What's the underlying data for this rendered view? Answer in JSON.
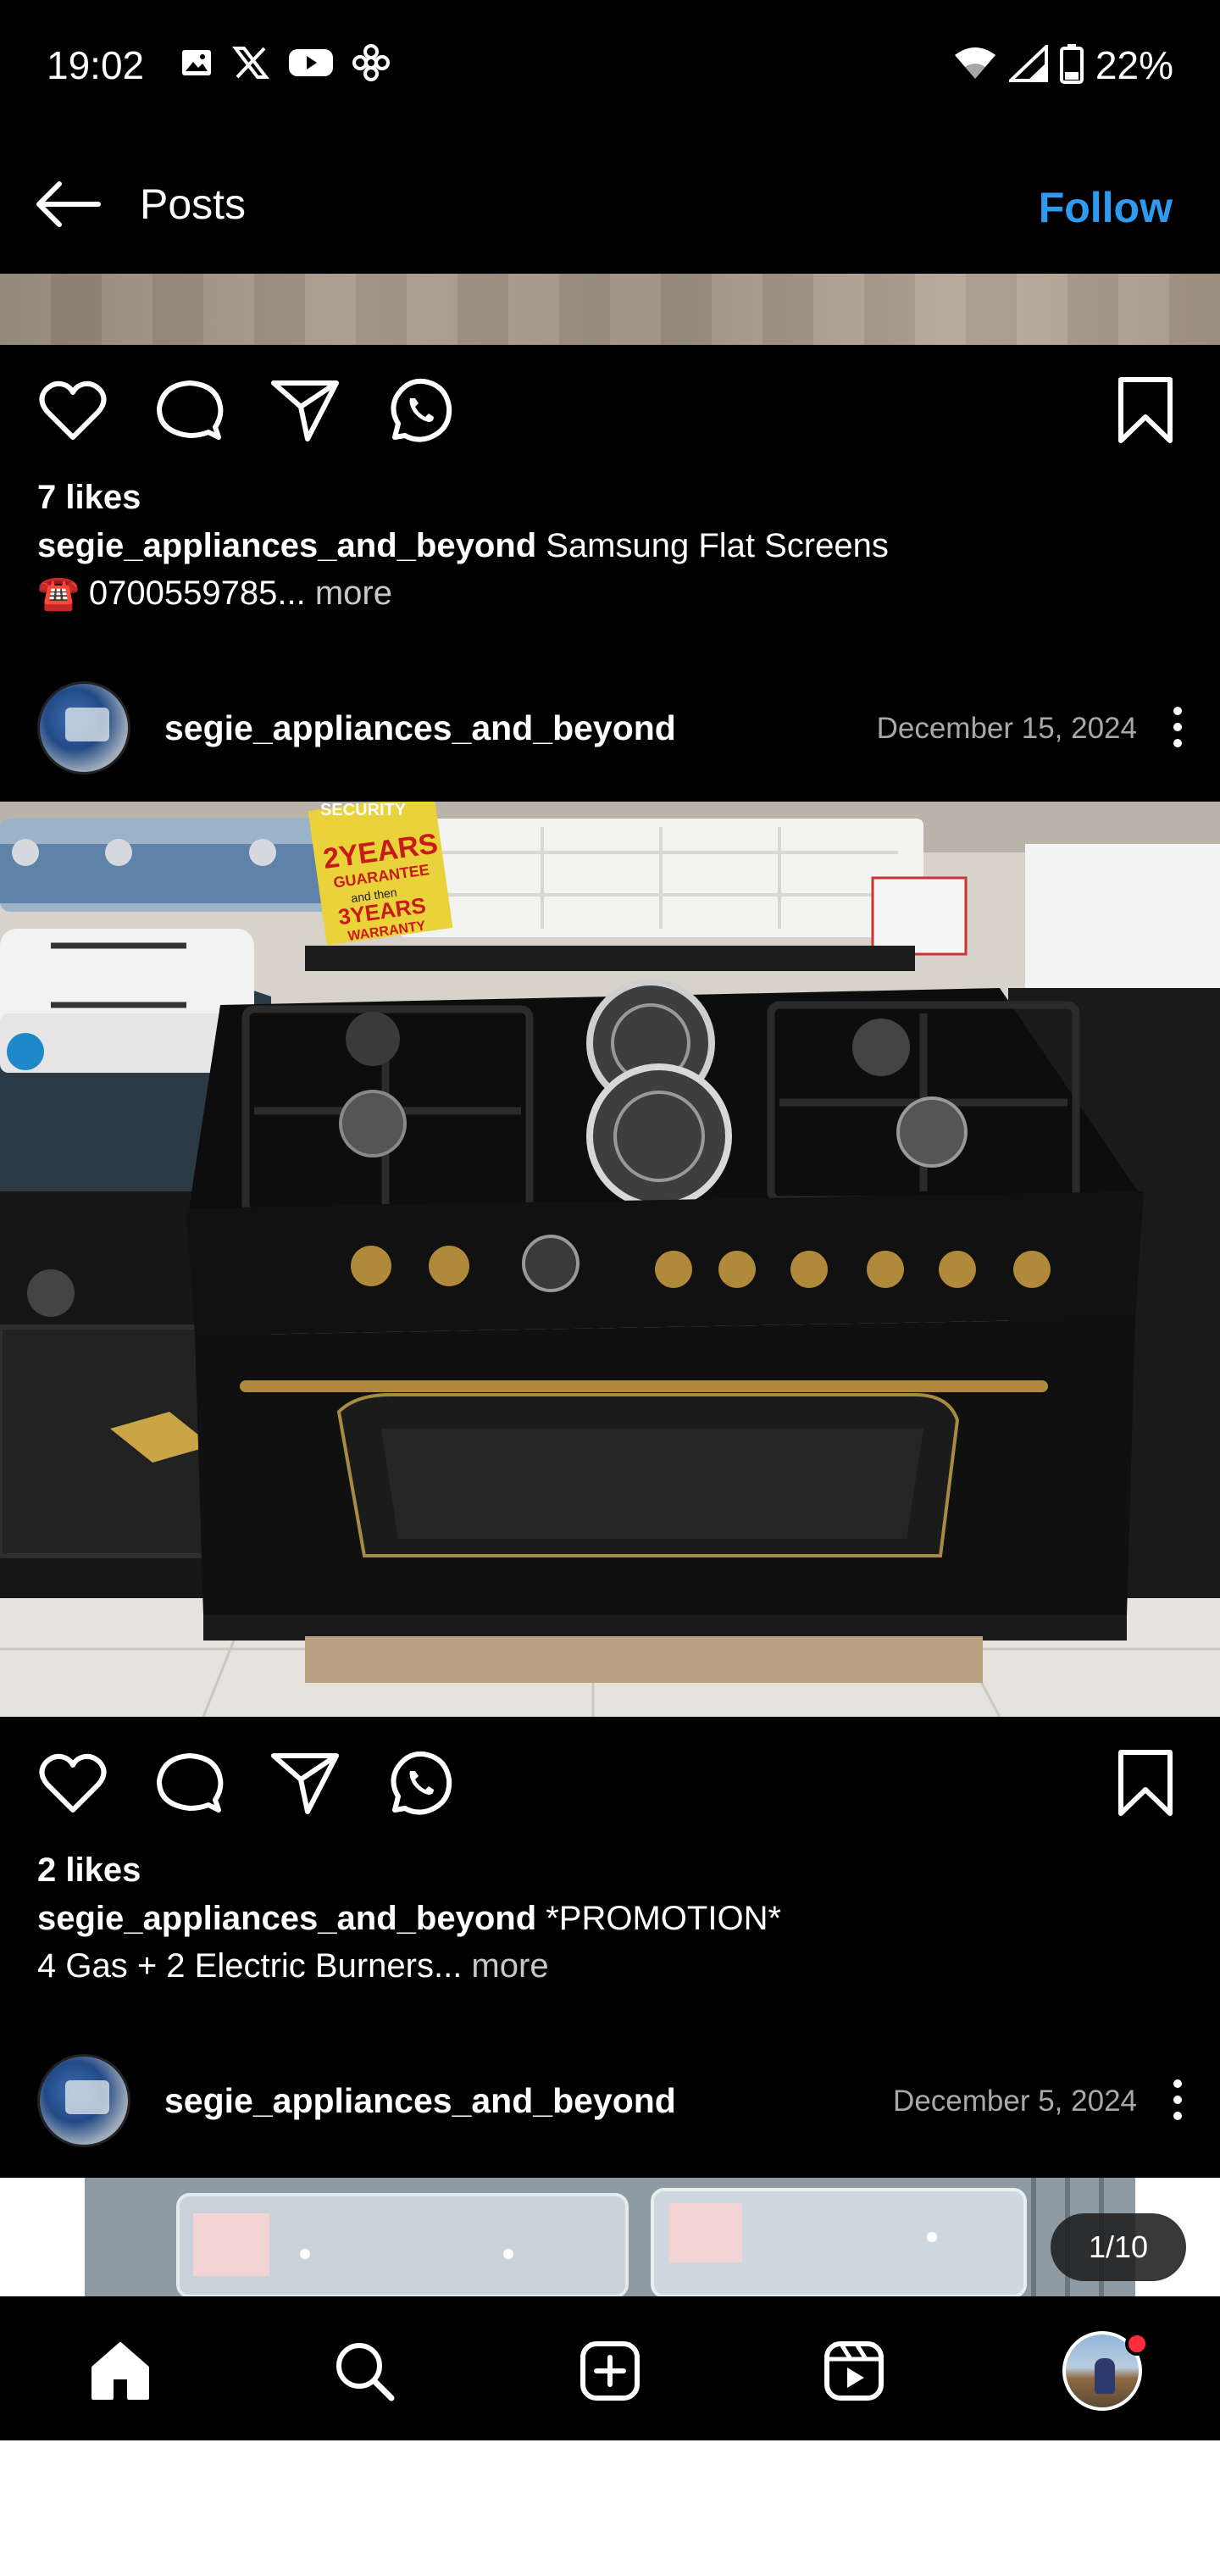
{
  "status_bar": {
    "time": "19:02",
    "battery": "22%",
    "left_icons": [
      "gallery-icon",
      "x-icon",
      "youtube-icon",
      "app-icon"
    ],
    "right_icons": [
      "wifi-icon",
      "signal-icon",
      "battery-icon"
    ]
  },
  "header": {
    "title": "Posts",
    "follow_label": "Follow"
  },
  "colors": {
    "follow": "#2f9bf0",
    "background": "#000000",
    "date": "#a8a8a8",
    "notification": "#ff2a3a"
  },
  "posts": [
    {
      "likes": "7 likes",
      "username": "segie_appliances_and_beyond",
      "caption_text": " Samsung Flat Screens",
      "caption_line2": "☎️ 0700559785...",
      "more_label": " more"
    },
    {
      "username": "segie_appliances_and_beyond",
      "date": "December 15, 2024",
      "image_labels": {
        "security": "SECURITY",
        "years2": "2YEARS",
        "guarantee": "GUARANTEE",
        "and_then": "and then",
        "years3": "3YEARS",
        "warranty": "WARRANTY"
      },
      "likes": "2 likes",
      "caption_text": " *PROMOTION*",
      "caption_line2": "4 Gas + 2 Electric Burners...",
      "more_label": " more"
    },
    {
      "username": "segie_appliances_and_beyond",
      "date": "December 5, 2024",
      "carousel_counter": "1/10"
    }
  ],
  "bottom_nav": {
    "items": [
      "home-icon",
      "search-icon",
      "create-icon",
      "reels-icon",
      "profile-avatar"
    ]
  }
}
